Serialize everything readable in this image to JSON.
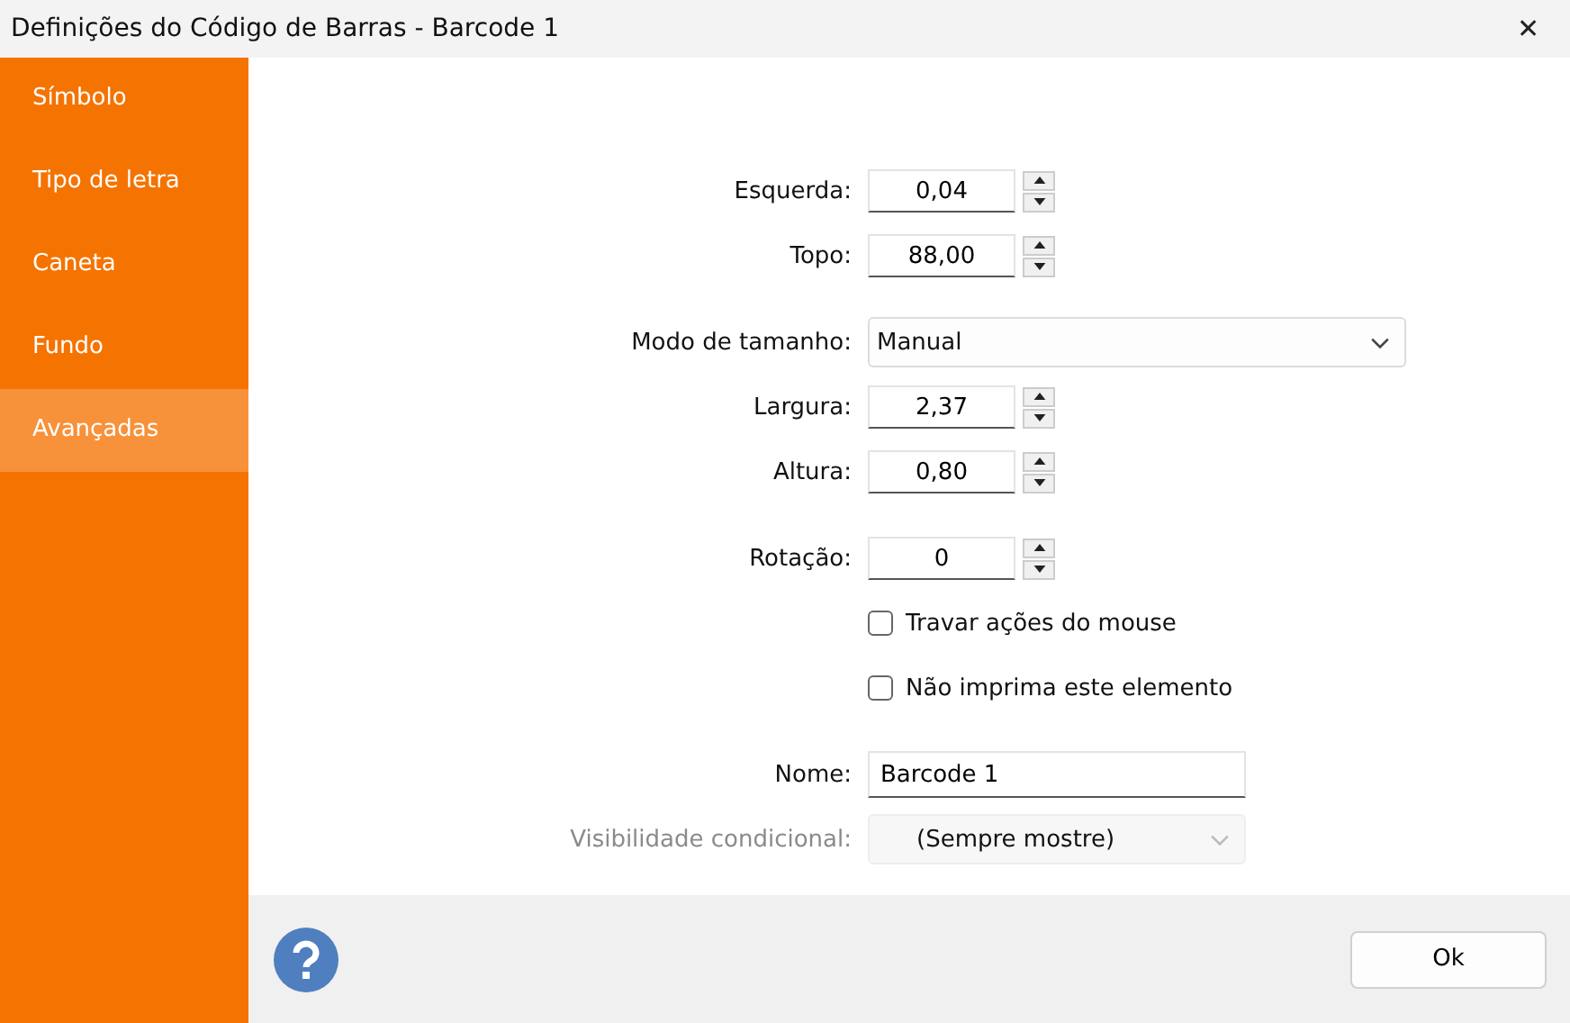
{
  "window": {
    "title": "Definições do Código de Barras - Barcode 1",
    "close": "✕"
  },
  "sidebar": {
    "items": [
      {
        "label": "Símbolo",
        "selected": false
      },
      {
        "label": "Tipo de letra",
        "selected": false
      },
      {
        "label": "Caneta",
        "selected": false
      },
      {
        "label": "Fundo",
        "selected": false
      },
      {
        "label": "Avançadas",
        "selected": true
      }
    ]
  },
  "groups": [
    [
      {
        "kind": "spin",
        "label": "Esquerda:",
        "value": "0,04"
      },
      {
        "kind": "spin",
        "label": "Topo:",
        "value": "88,00"
      }
    ],
    [
      {
        "kind": "select",
        "label": "Modo de tamanho:",
        "value": "Manual",
        "disabled": false
      },
      {
        "kind": "spin",
        "label": "Largura:",
        "value": "2,37"
      },
      {
        "kind": "spin",
        "label": "Altura:",
        "value": "0,80"
      }
    ],
    [
      {
        "kind": "spin",
        "label": "Rotação:",
        "value": "0"
      },
      {
        "kind": "checkbox",
        "label": "Travar ações do mouse",
        "checked": false
      },
      {
        "kind": "checkbox",
        "label": "Não imprima este elemento",
        "checked": false
      }
    ],
    [
      {
        "kind": "text",
        "label": "Nome:",
        "value": "Barcode 1"
      },
      {
        "kind": "select",
        "label": "Visibilidade condicional:",
        "value": "(Sempre mostre)",
        "disabled": true
      }
    ]
  ],
  "footer": {
    "ok": "Ok"
  }
}
